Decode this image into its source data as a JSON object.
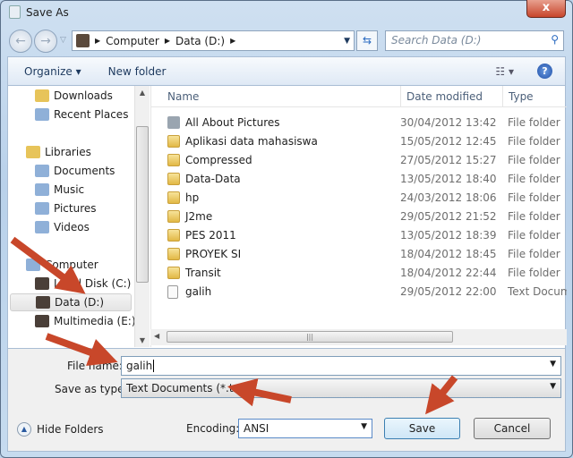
{
  "window": {
    "title": "Save As",
    "close": "x"
  },
  "address": {
    "crumbs": [
      "Computer",
      "Data (D:)"
    ]
  },
  "search": {
    "placeholder": "Search Data (D:)"
  },
  "toolbar": {
    "organize": "Organize ▾",
    "new_folder": "New folder"
  },
  "nav": [
    {
      "label": "Downloads",
      "icon": "downloads-folder-icon",
      "indent": 1
    },
    {
      "label": "Recent Places",
      "icon": "recent-places-icon",
      "indent": 1
    },
    {
      "label": "Libraries",
      "icon": "libraries-icon",
      "indent": 0
    },
    {
      "label": "Documents",
      "icon": "documents-icon",
      "indent": 1
    },
    {
      "label": "Music",
      "icon": "music-icon",
      "indent": 1
    },
    {
      "label": "Pictures",
      "icon": "pictures-icon",
      "indent": 1
    },
    {
      "label": "Videos",
      "icon": "videos-icon",
      "indent": 1
    },
    {
      "label": "Computer",
      "icon": "computer-icon",
      "indent": 0
    },
    {
      "label": "Local Disk (C:)",
      "icon": "drive-icon",
      "indent": 1
    },
    {
      "label": "Data (D:)",
      "icon": "drive-icon",
      "indent": 1,
      "selected": true
    },
    {
      "label": "Multimedia (E:)",
      "icon": "drive-icon",
      "indent": 1
    }
  ],
  "columns": {
    "name": "Name",
    "date": "Date modified",
    "type": "Type"
  },
  "files": [
    {
      "name": "All About Pictures",
      "date": "30/04/2012 13:42",
      "type": "File folder",
      "icon": "network-folder-icon"
    },
    {
      "name": "Aplikasi data mahasiswa",
      "date": "15/05/2012 12:45",
      "type": "File folder",
      "icon": "folder-icon"
    },
    {
      "name": "Compressed",
      "date": "27/05/2012 15:27",
      "type": "File folder",
      "icon": "folder-icon"
    },
    {
      "name": "Data-Data",
      "date": "13/05/2012 18:40",
      "type": "File folder",
      "icon": "folder-icon"
    },
    {
      "name": "hp",
      "date": "24/03/2012 18:06",
      "type": "File folder",
      "icon": "folder-icon"
    },
    {
      "name": "J2me",
      "date": "29/05/2012 21:52",
      "type": "File folder",
      "icon": "folder-icon"
    },
    {
      "name": "PES 2011",
      "date": "13/05/2012 18:39",
      "type": "File folder",
      "icon": "folder-icon"
    },
    {
      "name": "PROYEK SI",
      "date": "18/04/2012 18:45",
      "type": "File folder",
      "icon": "folder-icon"
    },
    {
      "name": "Transit",
      "date": "18/04/2012 22:44",
      "type": "File folder",
      "icon": "folder-icon"
    },
    {
      "name": "galih",
      "date": "29/05/2012 22:00",
      "type": "Text Document",
      "icon": "text-file-icon"
    }
  ],
  "form": {
    "file_name_label": "File name:",
    "file_name": "galih",
    "type_label": "Save as type:",
    "type_value": "Text Documents (*.txt)",
    "encoding_label": "Encoding:",
    "encoding": "ANSI"
  },
  "buttons": {
    "hide_folders": "Hide Folders",
    "save": "Save",
    "cancel": "Cancel"
  },
  "colors": {
    "annotation_arrow": "#c8472a",
    "accent": "#2a6ac0"
  }
}
